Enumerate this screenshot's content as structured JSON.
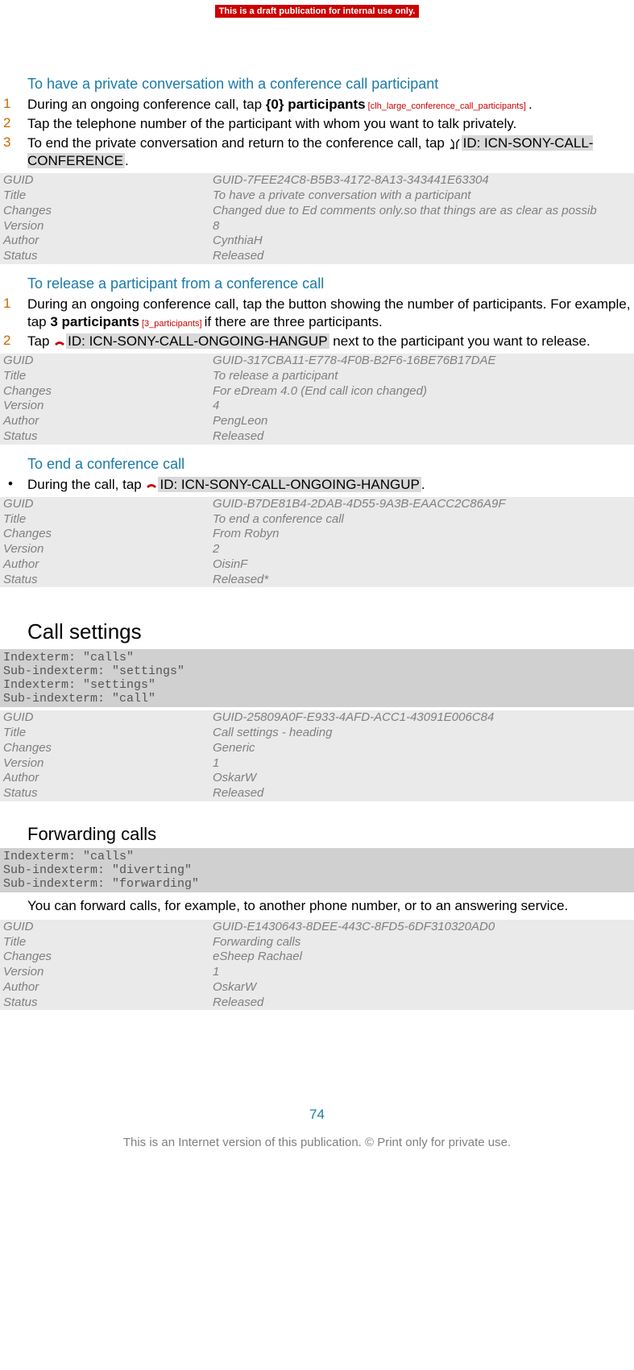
{
  "banner": "This is a draft publication for internal use only.",
  "s1": {
    "title": "To have a private conversation with a conference call participant",
    "step1a": "During an ongoing conference call, tap ",
    "step1b": "{0} participants",
    "step1tag": " [clh_large_conference_call_participants] ",
    "step1end": ".",
    "step2": "Tap the telephone number of the participant with whom you want to talk privately.",
    "step3a": "To end the private conversation and return to the conference call, tap ",
    "step3hl": "ID: ICN-SONY-CALL-CONFERENCE",
    "step3end": ".",
    "meta": {
      "guid": "GUID-7FEE24C8-B5B3-4172-8A13-343441E63304",
      "title": "To have a private conversation with a participant",
      "changes": "Changed due to Ed comments only.so that things are as clear as possib",
      "version": "8",
      "author": "CynthiaH",
      "status": "Released"
    }
  },
  "s2": {
    "title": "To release a participant from a conference call",
    "step1a": "During an ongoing conference call, tap the button showing the number of participants. For example, tap ",
    "step1b": "3 participants",
    "step1tag": " [3_participants] ",
    "step1c": "if there are three participants.",
    "step2a": "Tap ",
    "step2hl": "ID: ICN-SONY-CALL-ONGOING-HANGUP",
    "step2b": " next to the participant you want to release.",
    "meta": {
      "guid": "GUID-317CBA11-E778-4F0B-B2F6-16BE76B17DAE",
      "title": "To release a participant",
      "changes": "For eDream 4.0 (End call icon changed)",
      "version": "4",
      "author": "PengLeon",
      "status": "Released"
    }
  },
  "s3": {
    "title": "To end a conference call",
    "step1a": "During the call, tap ",
    "step1hl": "ID: ICN-SONY-CALL-ONGOING-HANGUP",
    "step1end": ".",
    "meta": {
      "guid": "GUID-B7DE81B4-2DAB-4D55-9A3B-EAACC2C86A9F",
      "title": "To end a conference call",
      "changes": "From Robyn",
      "version": "2",
      "author": "OisinF",
      "status": "Released*"
    }
  },
  "s4": {
    "heading": "Call settings",
    "index": "Indexterm: \"calls\"\nSub-indexterm: \"settings\"\nIndexterm: \"settings\"\nSub-indexterm: \"call\"",
    "meta": {
      "guid": "GUID-25809A0F-E933-4AFD-ACC1-43091E006C84",
      "title": "Call settings - heading",
      "changes": "Generic",
      "version": "1",
      "author": "OskarW",
      "status": "Released"
    }
  },
  "s5": {
    "heading": "Forwarding calls",
    "index": "Indexterm: \"calls\"\nSub-indexterm: \"diverting\"\nSub-indexterm: \"forwarding\"",
    "body": "You can forward calls, for example, to another phone number, or to an answering service.",
    "meta": {
      "guid": "GUID-E1430643-8DEE-443C-8FD5-6DF310320AD0",
      "title": "Forwarding calls",
      "changes": "eSheep Rachael",
      "version": "1",
      "author": "OskarW",
      "status": "Released"
    }
  },
  "labels": {
    "guid": "GUID",
    "title": "Title",
    "changes": "Changes",
    "version": "Version",
    "author": "Author",
    "status": "Status"
  },
  "pagenum": "74",
  "footer": "This is an Internet version of this publication. © Print only for private use."
}
